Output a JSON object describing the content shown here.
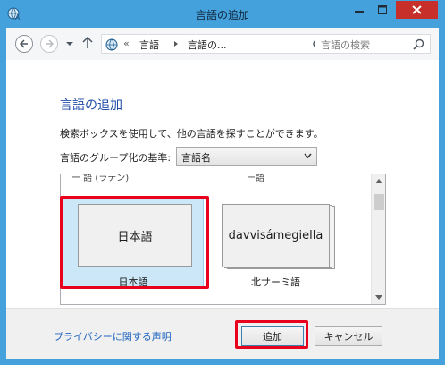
{
  "window": {
    "title": "言語の追加"
  },
  "navigation": {
    "address_segment_1": "言語",
    "address_segment_2": "言語の...",
    "address_overflow": "«",
    "search_placeholder": "言語の検索"
  },
  "content": {
    "heading": "言語の追加",
    "description": "検索ボックスを使用して、他の言語を探すことができます。",
    "group_label": "言語のグループ化の基準:",
    "group_value": "言語名"
  },
  "language_list": {
    "peek_left": "ー 語 (ラテン)",
    "peek_right": "ー語",
    "items": [
      {
        "tile_text": "日本語",
        "caption": "日本語",
        "selected": true
      },
      {
        "tile_text": "davvisámegiella",
        "caption": "北サーミ語",
        "selected": false
      }
    ]
  },
  "footer": {
    "privacy_link": "プライバシーに関する声明",
    "add_button": "追加",
    "cancel_button": "キャンセル"
  },
  "colors": {
    "titlebar": "#45a1dc",
    "close_button": "#c7302a",
    "heading": "#1f4aa8",
    "link": "#1f64c0",
    "selection": "#cce8f8",
    "highlight": "#e8001c"
  }
}
